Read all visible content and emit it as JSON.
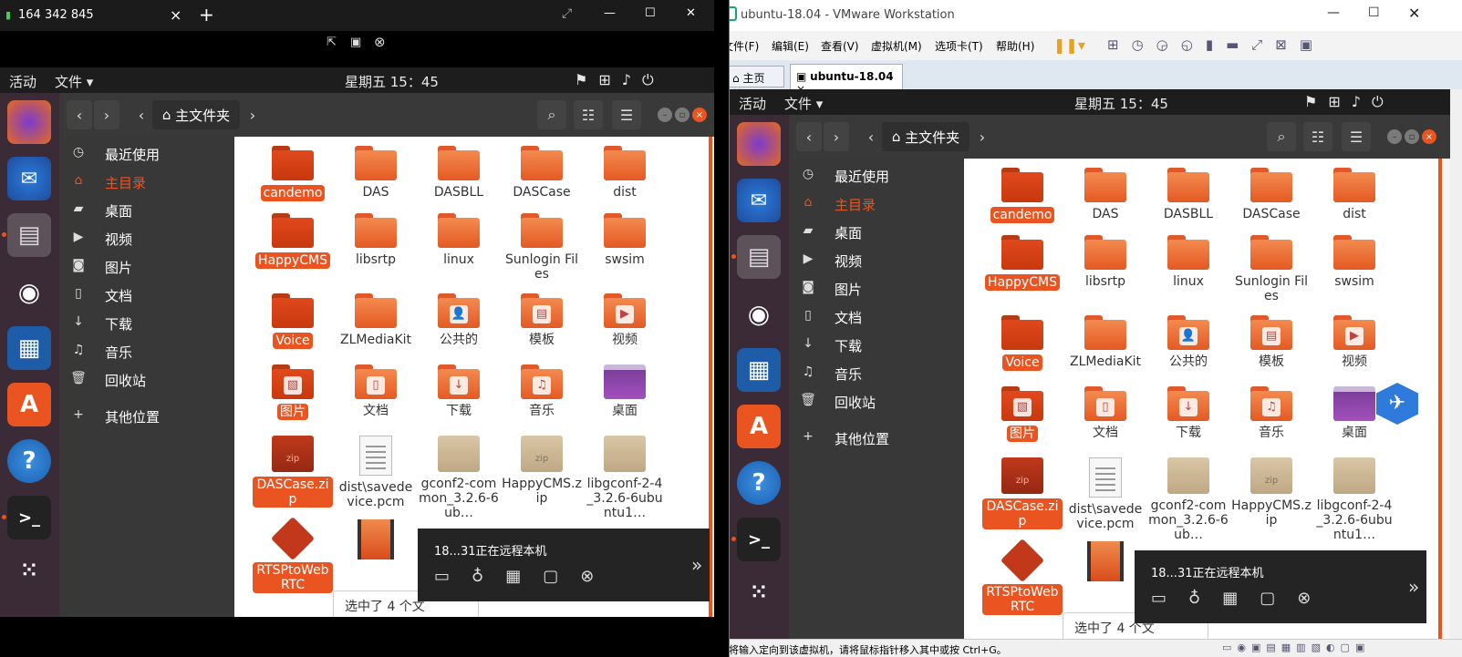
{
  "left_window": {
    "title": "164 342 845",
    "controls": {
      "close": "×",
      "new_tab": "+",
      "fullscreen": "⤢",
      "minimize": "—",
      "maximize": "☐",
      "close_win": "✕"
    }
  },
  "right_window": {
    "title": "ubuntu-18.04 - VMware Workstation",
    "menu": [
      "文件(F)",
      "编辑(E)",
      "查看(V)",
      "虚拟机(M)",
      "选项卡(T)",
      "帮助(H)"
    ],
    "tabs": [
      {
        "label": "主页"
      },
      {
        "label": "ubuntu-18.04"
      }
    ],
    "status": "要将输入定向到该虚拟机，请将鼠标指针移入其中或按 Ctrl+G。"
  },
  "ubuntu": {
    "activities": "活动",
    "files_menu": "文件 ▾",
    "clock": "星期五 15：45",
    "breadcrumb": "主文件夹",
    "sidebar": [
      "最近使用",
      "主目录",
      "桌面",
      "视频",
      "图片",
      "文档",
      "下载",
      "音乐",
      "回收站",
      "其他位置"
    ],
    "files": [
      {
        "name": "candemo",
        "type": "folder",
        "selected": true
      },
      {
        "name": "DAS",
        "type": "folder"
      },
      {
        "name": "DASBLL",
        "type": "folder"
      },
      {
        "name": "DASCase",
        "type": "folder"
      },
      {
        "name": "dist",
        "type": "folder"
      },
      {
        "name": "HappyCMS",
        "type": "folder",
        "selected": true
      },
      {
        "name": "libsrtp",
        "type": "folder"
      },
      {
        "name": "linux",
        "type": "folder"
      },
      {
        "name": "Sunlogin Files",
        "type": "folder"
      },
      {
        "name": "swsim",
        "type": "folder"
      },
      {
        "name": "Voice",
        "type": "folder",
        "selected": true
      },
      {
        "name": "ZLMediaKit",
        "type": "folder"
      },
      {
        "name": "公共的",
        "type": "folder-public"
      },
      {
        "name": "模板",
        "type": "folder-templates"
      },
      {
        "name": "视频",
        "type": "folder-videos"
      },
      {
        "name": "图片",
        "type": "folder-pictures",
        "selected": true
      },
      {
        "name": "文档",
        "type": "folder-documents"
      },
      {
        "name": "下载",
        "type": "folder-downloads"
      },
      {
        "name": "音乐",
        "type": "folder-music"
      },
      {
        "name": "桌面",
        "type": "folder-desktop"
      },
      {
        "name": "DASCase.zip",
        "type": "zip-red",
        "selected": true
      },
      {
        "name": "dist\\savedevice.pcm",
        "type": "doc"
      },
      {
        "name": "gconf2-common_3.2.6-6ub…",
        "type": "package"
      },
      {
        "name": "HappyCMS.zip",
        "type": "zip"
      },
      {
        "name": "libgconf-2-4_3.2.6-6ubuntu1…",
        "type": "package"
      },
      {
        "name": "RTSPtoWebRTC",
        "type": "diamond",
        "selected": true
      },
      {
        "name": "",
        "type": "video"
      }
    ],
    "status_text": "选中了 4 个文"
  },
  "remote_popup": {
    "who": "18...31正在远程本机",
    "buttons": [
      "chat",
      "mic",
      "keyboard",
      "text",
      "close"
    ]
  },
  "colors": {
    "accent": "#e95420",
    "dock": "#3a2b36",
    "header": "#393939"
  }
}
